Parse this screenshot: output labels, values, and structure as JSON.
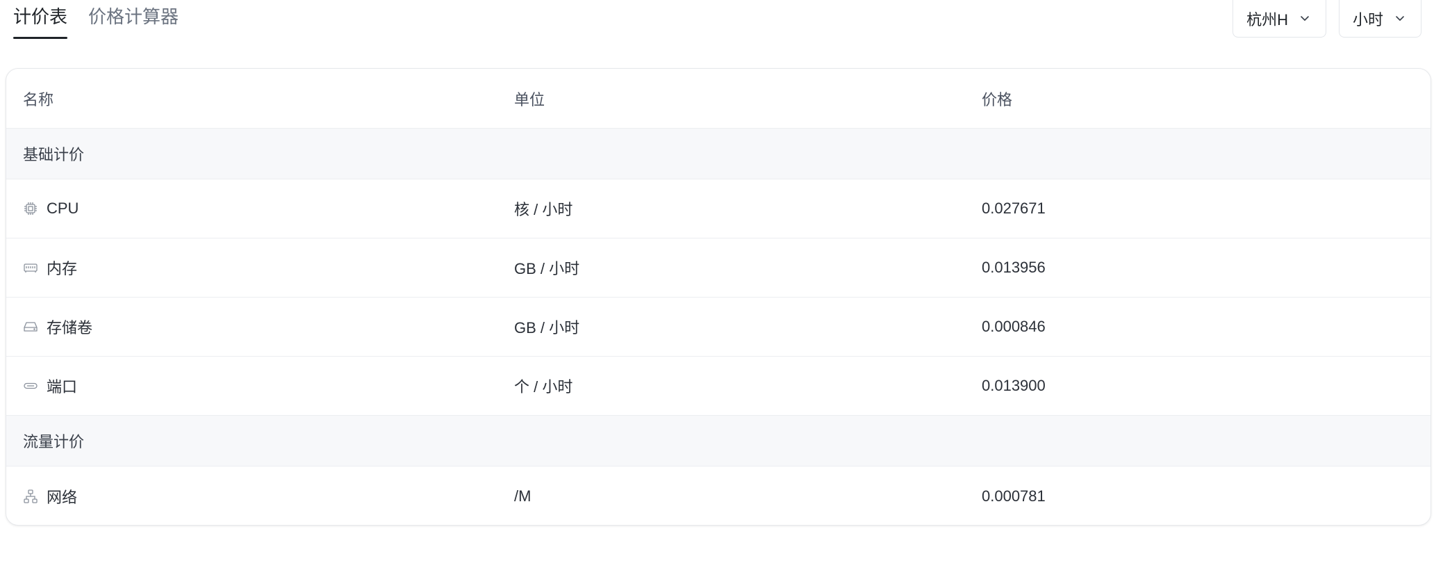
{
  "tabs": [
    {
      "label": "计价表",
      "active": true
    },
    {
      "label": "价格计算器",
      "active": false
    }
  ],
  "selects": {
    "region": "杭州H",
    "period": "小时"
  },
  "table": {
    "headers": {
      "name": "名称",
      "unit": "单位",
      "price": "价格"
    },
    "groups": [
      {
        "title": "基础计价",
        "rows": [
          {
            "icon": "cpu-icon",
            "name": "CPU",
            "unit": "核 / 小时",
            "price": "0.027671"
          },
          {
            "icon": "memory-icon",
            "name": "内存",
            "unit": "GB / 小时",
            "price": "0.013956"
          },
          {
            "icon": "storage-volume-icon",
            "name": "存储卷",
            "unit": "GB / 小时",
            "price": "0.000846"
          },
          {
            "icon": "port-icon",
            "name": "端口",
            "unit": "个 / 小时",
            "price": "0.013900"
          }
        ]
      },
      {
        "title": "流量计价",
        "rows": [
          {
            "icon": "network-icon",
            "name": "网络",
            "unit": "/M",
            "price": "0.000781"
          }
        ]
      }
    ]
  }
}
